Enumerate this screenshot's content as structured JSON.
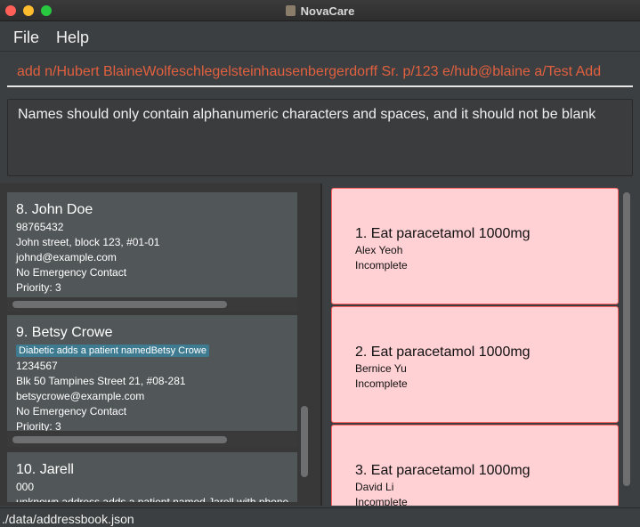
{
  "window": {
    "title": "NovaCare"
  },
  "menu": {
    "file": "File",
    "help": "Help"
  },
  "command_box": {
    "value": "add n/Hubert BlaineWolfeschlegelsteinhausenbergerdorff Sr. p/123 e/hub@blaine a/Test Add"
  },
  "result": {
    "text": "Names should only contain alphanumeric characters and spaces, and it should not be blank"
  },
  "persons": [
    {
      "name": "8. John Doe",
      "phone": "98765432",
      "address": "John street, block 123, #01-01",
      "email": "johnd@example.com",
      "emergency": "No Emergency Contact",
      "priority": "Priority: 3"
    },
    {
      "name": "9. Betsy Crowe",
      "tag": "Diabetic adds a patient namedBetsy Crowe",
      "phone": "1234567",
      "address": "Blk 50 Tampines Street 21, #08-281",
      "email": "betsycrowe@example.com",
      "emergency": "No Emergency Contact",
      "priority": "Priority: 3"
    },
    {
      "name": "10. Jarell",
      "phone": "000",
      "address": "unknown address adds a patient named Jarell with phone"
    }
  ],
  "tasks": [
    {
      "title": "1. Eat paracetamol 1000mg",
      "patient": "Alex Yeoh",
      "status": "Incomplete"
    },
    {
      "title": "2. Eat paracetamol 1000mg",
      "patient": "Bernice Yu",
      "status": "Incomplete"
    },
    {
      "title": "3. Eat paracetamol 1000mg",
      "patient": "David Li",
      "status": "Incomplete"
    }
  ],
  "status_bar": {
    "path": "./data/addressbook.json"
  },
  "colors": {
    "task_bg": "#ffd0d4",
    "task_border": "#ff6060",
    "error_text": "#e0603f",
    "tag_bg": "#3e7b91"
  },
  "icons": [
    "close-window-icon",
    "minimize-window-icon",
    "maximize-window-icon",
    "app-icon"
  ]
}
